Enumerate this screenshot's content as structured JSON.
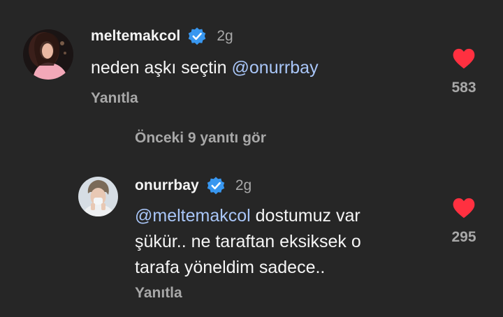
{
  "comments": [
    {
      "username": "meltemakcol",
      "verified": true,
      "time": "2g",
      "mention": "",
      "text": "neden aşkı seçtin ",
      "text_mention": "@onurrbay",
      "reply_label": "Yanıtla",
      "likes": "583",
      "heart_color": "#ff3040",
      "avatar_icon": "profile-photo"
    },
    {
      "username": "onurrbay",
      "verified": true,
      "time": "2g",
      "mention": "@meltemakcol",
      "line1": " dostumuz var",
      "line2": "şükür.. ne taraftan eksiksek o",
      "line3": "tarafa yöneldim sadece..",
      "reply_label": "Yanıtla",
      "likes": "295",
      "heart_color": "#ff3040",
      "avatar_icon": "profile-photo"
    }
  ],
  "view_previous_replies": "Önceki 9 yanıtı gör",
  "colors": {
    "background": "#262626",
    "text": "#f5f5f5",
    "secondary": "#a8a8a8",
    "mention": "#a9c6f8",
    "verified": "#3897f0",
    "heart": "#ff3040"
  }
}
